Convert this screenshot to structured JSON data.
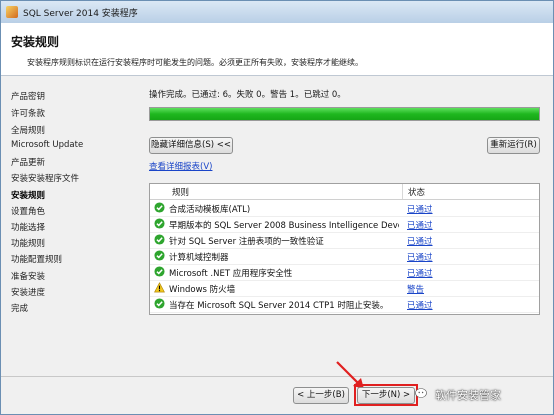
{
  "window": {
    "title": "SQL Server 2014 安装程序"
  },
  "header": {
    "title": "安装规则",
    "description": "安装程序规则标识在运行安装程序时可能发生的问题。必须更正所有失败，安装程序才能继续。"
  },
  "sidebar": {
    "items": [
      {
        "label": "产品密钥",
        "active": false
      },
      {
        "label": "许可条款",
        "active": false
      },
      {
        "label": "全局规则",
        "active": false
      },
      {
        "label": "Microsoft Update",
        "active": false
      },
      {
        "label": "产品更新",
        "active": false
      },
      {
        "label": "安装安装程序文件",
        "active": false
      },
      {
        "label": "安装规则",
        "active": true
      },
      {
        "label": "设置角色",
        "active": false
      },
      {
        "label": "功能选择",
        "active": false
      },
      {
        "label": "功能规则",
        "active": false
      },
      {
        "label": "功能配置规则",
        "active": false
      },
      {
        "label": "准备安装",
        "active": false
      },
      {
        "label": "安装进度",
        "active": false
      },
      {
        "label": "完成",
        "active": false
      }
    ]
  },
  "main": {
    "status_text": "操作完成。已通过: 6。失败 0。警告 1。已跳过 0。",
    "progress_percent": 100,
    "hide_details_label": "隐藏详细信息(S) <<",
    "rerun_label": "重新运行(R)",
    "view_report_label": "查看详细报表(V)",
    "table": {
      "columns": [
        "规则",
        "状态"
      ],
      "rows": [
        {
          "icon": "check-icon",
          "rule": "合成活动模板库(ATL)",
          "status": "已通过"
        },
        {
          "icon": "check-icon",
          "rule": "早期版本的 SQL Server 2008 Business Intelligence Develo...",
          "status": "已通过"
        },
        {
          "icon": "check-icon",
          "rule": "针对 SQL Server 注册表项的一致性验证",
          "status": "已通过"
        },
        {
          "icon": "check-icon",
          "rule": "计算机域控制器",
          "status": "已通过"
        },
        {
          "icon": "check-icon",
          "rule": "Microsoft .NET 应用程序安全性",
          "status": "已通过"
        },
        {
          "icon": "warning-icon",
          "rule": "Windows 防火墙",
          "status": "警告"
        },
        {
          "icon": "check-icon",
          "rule": "当存在 Microsoft SQL Server 2014 CTP1 时阻止安装。",
          "status": "已通过"
        }
      ]
    }
  },
  "footer": {
    "back_label": "< 上一步(B)",
    "next_label": "下一步(N) >",
    "watermark_text": "软件安装管家"
  },
  "colors": {
    "accent_green": "#1fb71f",
    "link_blue": "#1a45c8",
    "highlight_red": "#e02020"
  }
}
